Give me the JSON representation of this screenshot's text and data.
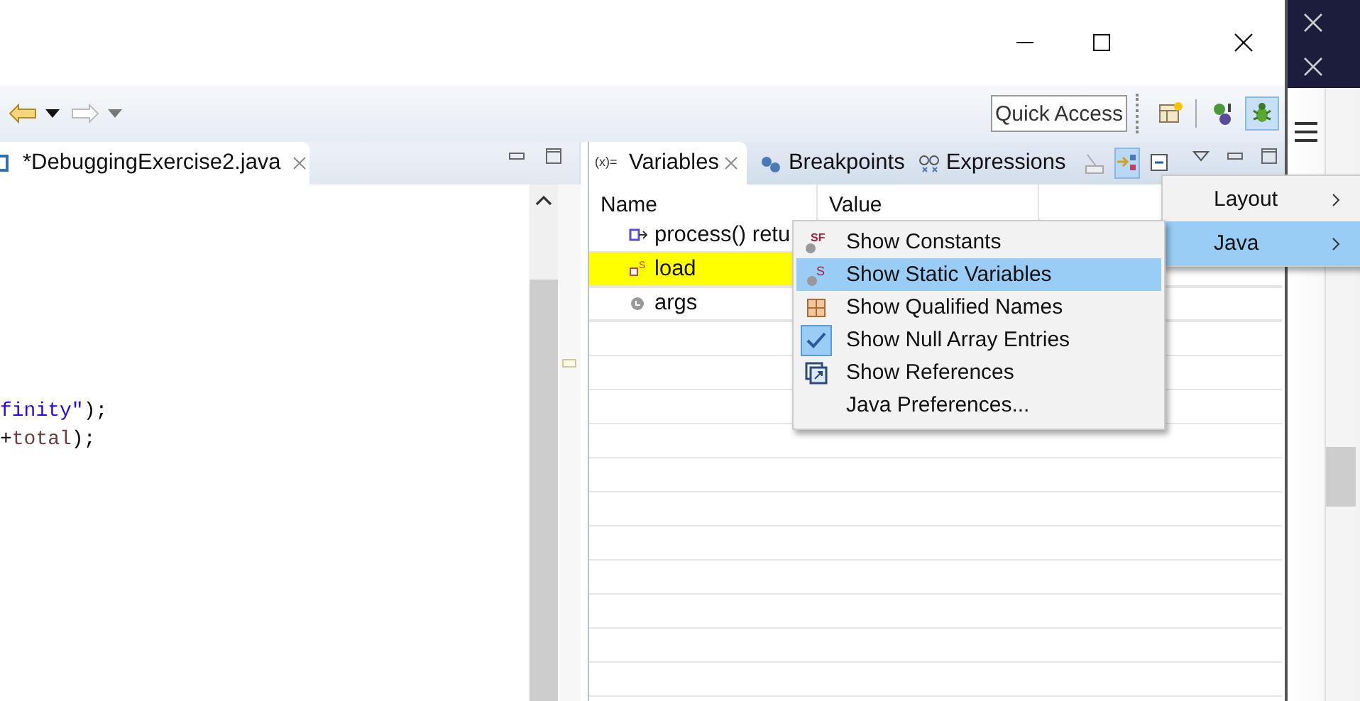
{
  "toolbar": {
    "quick_access": {
      "placeholder": "Quick Access"
    },
    "perspectives": [
      {
        "kind": "java-ee",
        "selected": false
      },
      {
        "kind": "debug-java",
        "selected": false
      },
      {
        "kind": "debug",
        "selected": true
      }
    ]
  },
  "editor": {
    "tab": {
      "label": "*DebuggingExercise2.java",
      "selected": true
    },
    "code_lines": [
      {
        "tokens": [
          {
            "kind": "string",
            "text": "finity\""
          },
          {
            "kind": "plain",
            "text": ");"
          }
        ]
      },
      {
        "tokens": [
          {
            "kind": "plain",
            "text": "+"
          },
          {
            "kind": "variable",
            "text": "total"
          },
          {
            "kind": "plain",
            "text": ");"
          }
        ]
      }
    ]
  },
  "debug_view": {
    "tabs": [
      {
        "label": "Variables",
        "kind": "variables",
        "icon_text": "(x)=",
        "selected": true
      },
      {
        "label": "Breakpoints",
        "kind": "breakpoints",
        "selected": false
      },
      {
        "label": "Expressions",
        "kind": "expressions",
        "selected": false
      }
    ],
    "tools": [
      {
        "kind": "show-type",
        "on": false
      },
      {
        "kind": "layout",
        "on": true
      },
      {
        "kind": "collapse",
        "on": false
      }
    ],
    "columns": [
      "Name",
      "Value"
    ],
    "rows": [
      {
        "name": "process() retu",
        "kind": "return",
        "highlighted": false
      },
      {
        "name": "load",
        "kind": "static",
        "badge": "S",
        "highlighted": true
      },
      {
        "name": "args",
        "kind": "local",
        "highlighted": false
      }
    ]
  },
  "view_menu": {
    "items": [
      {
        "label": "Layout",
        "selected": false
      },
      {
        "label": "Java",
        "selected": true
      }
    ]
  },
  "java_menu": {
    "items": [
      {
        "label": "Show Constants",
        "kind": "constants",
        "badge": "SF",
        "checked": false,
        "selected": false
      },
      {
        "label": "Show Static Variables",
        "kind": "static",
        "badge": "S",
        "checked": false,
        "selected": true
      },
      {
        "label": "Show Qualified Names",
        "kind": "qualified",
        "checked": false,
        "selected": false
      },
      {
        "label": "Show Null Array Entries",
        "kind": "tick",
        "checked": true,
        "selected": false
      },
      {
        "label": "Show References",
        "kind": "references",
        "checked": false,
        "selected": false
      },
      {
        "label": "Java Preferences...",
        "kind": "none",
        "checked": false,
        "selected": false
      }
    ]
  }
}
